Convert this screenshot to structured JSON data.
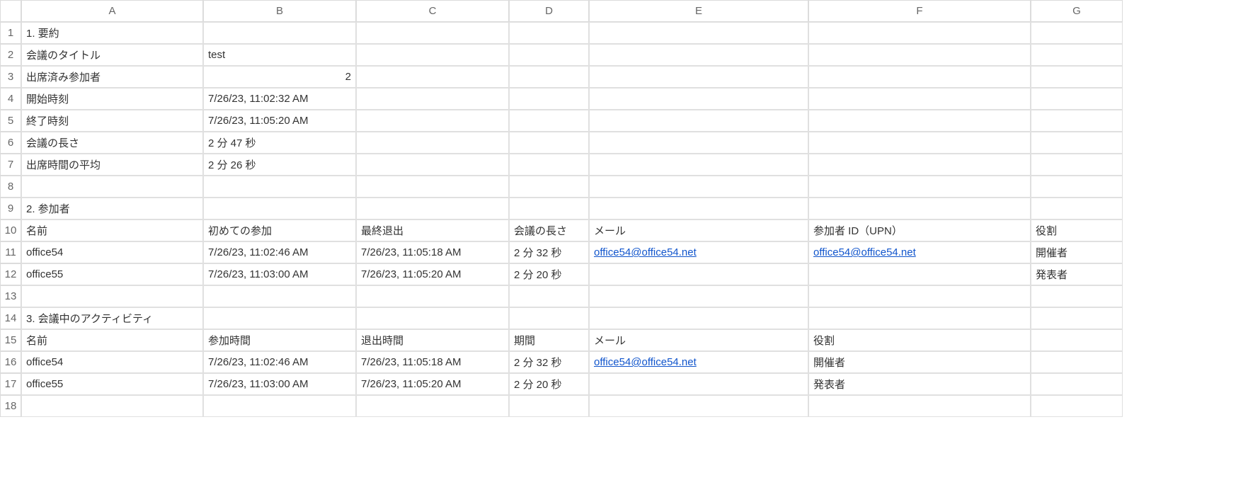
{
  "columns": [
    "A",
    "B",
    "C",
    "D",
    "E",
    "F",
    "G"
  ],
  "rows": [
    {
      "n": "1",
      "A": "1. 要約"
    },
    {
      "n": "2",
      "A": "会議のタイトル",
      "B": "test"
    },
    {
      "n": "3",
      "A": "出席済み参加者",
      "B": "2",
      "B_align": "right"
    },
    {
      "n": "4",
      "A": "開始時刻",
      "B": "7/26/23, 11:02:32 AM"
    },
    {
      "n": "5",
      "A": "終了時刻",
      "B": "7/26/23, 11:05:20 AM"
    },
    {
      "n": "6",
      "A": "会議の長さ",
      "B": "2 分 47 秒"
    },
    {
      "n": "7",
      "A": "出席時間の平均",
      "B": "2 分 26 秒"
    },
    {
      "n": "8"
    },
    {
      "n": "9",
      "A": "2. 参加者"
    },
    {
      "n": "10",
      "A": "名前",
      "B": "初めての参加",
      "C": "最終退出",
      "D": "会議の長さ",
      "E": "メール",
      "F": "参加者 ID（UPN）",
      "G": "役割"
    },
    {
      "n": "11",
      "A": "office54",
      "B": "7/26/23, 11:02:46 AM",
      "C": "7/26/23, 11:05:18 AM",
      "D": "2 分 32 秒",
      "E": "office54@office54.net",
      "E_link": true,
      "F": "office54@office54.net",
      "F_link": true,
      "G": "開催者"
    },
    {
      "n": "12",
      "A": "office55",
      "B": "7/26/23, 11:03:00 AM",
      "C": "7/26/23, 11:05:20 AM",
      "D": "2 分 20 秒",
      "G": "発表者"
    },
    {
      "n": "13"
    },
    {
      "n": "14",
      "A": "3. 会議中のアクティビティ"
    },
    {
      "n": "15",
      "A": "名前",
      "B": "参加時間",
      "C": "退出時間",
      "D": "期間",
      "E": "メール",
      "F": "役割"
    },
    {
      "n": "16",
      "A": "office54",
      "B": "7/26/23, 11:02:46 AM",
      "C": "7/26/23, 11:05:18 AM",
      "D": "2 分 32 秒",
      "E": "office54@office54.net",
      "E_link": true,
      "F": "開催者"
    },
    {
      "n": "17",
      "A": "office55",
      "B": "7/26/23, 11:03:00 AM",
      "C": "7/26/23, 11:05:20 AM",
      "D": "2 分 20 秒",
      "F": "発表者"
    },
    {
      "n": "18"
    }
  ]
}
